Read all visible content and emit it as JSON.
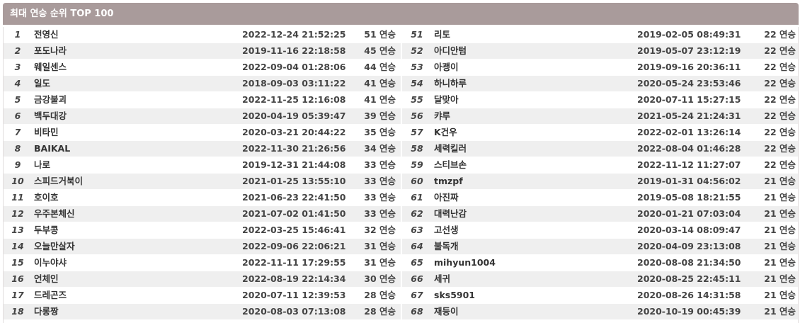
{
  "title": "최대 연승 순위 TOP 100",
  "colors": {
    "header_bg": "#a99b9b",
    "row_alt": "#efefef"
  },
  "left": [
    {
      "rank": "1",
      "name": "전영신",
      "date": "2022-12-24 21:52:25",
      "streak": "51 연승"
    },
    {
      "rank": "2",
      "name": "포도나라",
      "date": "2019-11-16 22:18:58",
      "streak": "45 연승"
    },
    {
      "rank": "3",
      "name": "웨일센스",
      "date": "2022-09-04 01:28:06",
      "streak": "44 연승"
    },
    {
      "rank": "4",
      "name": "일도",
      "date": "2018-09-03 03:11:22",
      "streak": "41 연승"
    },
    {
      "rank": "5",
      "name": "금강불괴",
      "date": "2022-11-25 12:16:08",
      "streak": "41 연승"
    },
    {
      "rank": "6",
      "name": "백두대강",
      "date": "2020-04-19 05:39:47",
      "streak": "39 연승"
    },
    {
      "rank": "7",
      "name": "비타민",
      "date": "2020-03-21 20:44:22",
      "streak": "35 연승"
    },
    {
      "rank": "8",
      "name": "BAIKAL",
      "date": "2022-11-30 21:26:56",
      "streak": "34 연승"
    },
    {
      "rank": "9",
      "name": "나로",
      "date": "2019-12-31 21:44:08",
      "streak": "33 연승"
    },
    {
      "rank": "10",
      "name": "스피드거북이",
      "date": "2021-01-25 13:55:10",
      "streak": "33 연승"
    },
    {
      "rank": "11",
      "name": "호이호",
      "date": "2021-06-23 22:41:50",
      "streak": "33 연승"
    },
    {
      "rank": "12",
      "name": "우주본체신",
      "date": "2021-07-02 01:41:50",
      "streak": "33 연승"
    },
    {
      "rank": "13",
      "name": "두부콩",
      "date": "2022-03-25 15:46:41",
      "streak": "32 연승"
    },
    {
      "rank": "14",
      "name": "오늘만살자",
      "date": "2022-09-06 22:06:21",
      "streak": "31 연승"
    },
    {
      "rank": "15",
      "name": "이누야샤",
      "date": "2022-11-11 17:29:55",
      "streak": "31 연승"
    },
    {
      "rank": "16",
      "name": "언체인",
      "date": "2022-08-19 22:14:34",
      "streak": "30 연승"
    },
    {
      "rank": "17",
      "name": "드레곤즈",
      "date": "2020-07-11 12:39:53",
      "streak": "28 연승"
    },
    {
      "rank": "18",
      "name": "다롱짱",
      "date": "2020-08-03 07:13:08",
      "streak": "28 연승"
    }
  ],
  "right": [
    {
      "rank": "51",
      "name": "리토",
      "date": "2019-02-05 08:49:31",
      "streak": "22 연승"
    },
    {
      "rank": "52",
      "name": "아디안텀",
      "date": "2019-05-07 23:12:19",
      "streak": "22 연승"
    },
    {
      "rank": "53",
      "name": "아괭이",
      "date": "2019-09-16 20:36:11",
      "streak": "22 연승"
    },
    {
      "rank": "54",
      "name": "하니하루",
      "date": "2020-05-24 23:53:46",
      "streak": "22 연승"
    },
    {
      "rank": "55",
      "name": "달맞아",
      "date": "2020-07-11 15:27:15",
      "streak": "22 연승"
    },
    {
      "rank": "56",
      "name": "캬루",
      "date": "2021-05-24 21:24:31",
      "streak": "22 연승"
    },
    {
      "rank": "57",
      "name": "K건우",
      "date": "2022-02-01 13:26:14",
      "streak": "22 연승"
    },
    {
      "rank": "58",
      "name": "세력킬러",
      "date": "2022-08-04 01:46:28",
      "streak": "22 연승"
    },
    {
      "rank": "59",
      "name": "스티브손",
      "date": "2022-11-12 11:27:07",
      "streak": "22 연승"
    },
    {
      "rank": "60",
      "name": "tmzpf",
      "date": "2019-01-31 04:56:02",
      "streak": "21 연승"
    },
    {
      "rank": "61",
      "name": "아진짜",
      "date": "2019-05-08 18:21:55",
      "streak": "21 연승"
    },
    {
      "rank": "62",
      "name": "대력난감",
      "date": "2020-01-21 07:03:04",
      "streak": "21 연승"
    },
    {
      "rank": "63",
      "name": "고선생",
      "date": "2020-03-14 08:09:47",
      "streak": "21 연승"
    },
    {
      "rank": "64",
      "name": "불독개",
      "date": "2020-04-09 23:13:08",
      "streak": "21 연승"
    },
    {
      "rank": "65",
      "name": "mihyun1004",
      "date": "2020-08-08 21:34:50",
      "streak": "21 연승"
    },
    {
      "rank": "66",
      "name": "세귀",
      "date": "2020-08-25 22:45:11",
      "streak": "21 연승"
    },
    {
      "rank": "67",
      "name": "sks5901",
      "date": "2020-08-26 14:31:58",
      "streak": "21 연승"
    },
    {
      "rank": "68",
      "name": "재등이",
      "date": "2020-10-19 00:45:39",
      "streak": "21 연승"
    }
  ]
}
